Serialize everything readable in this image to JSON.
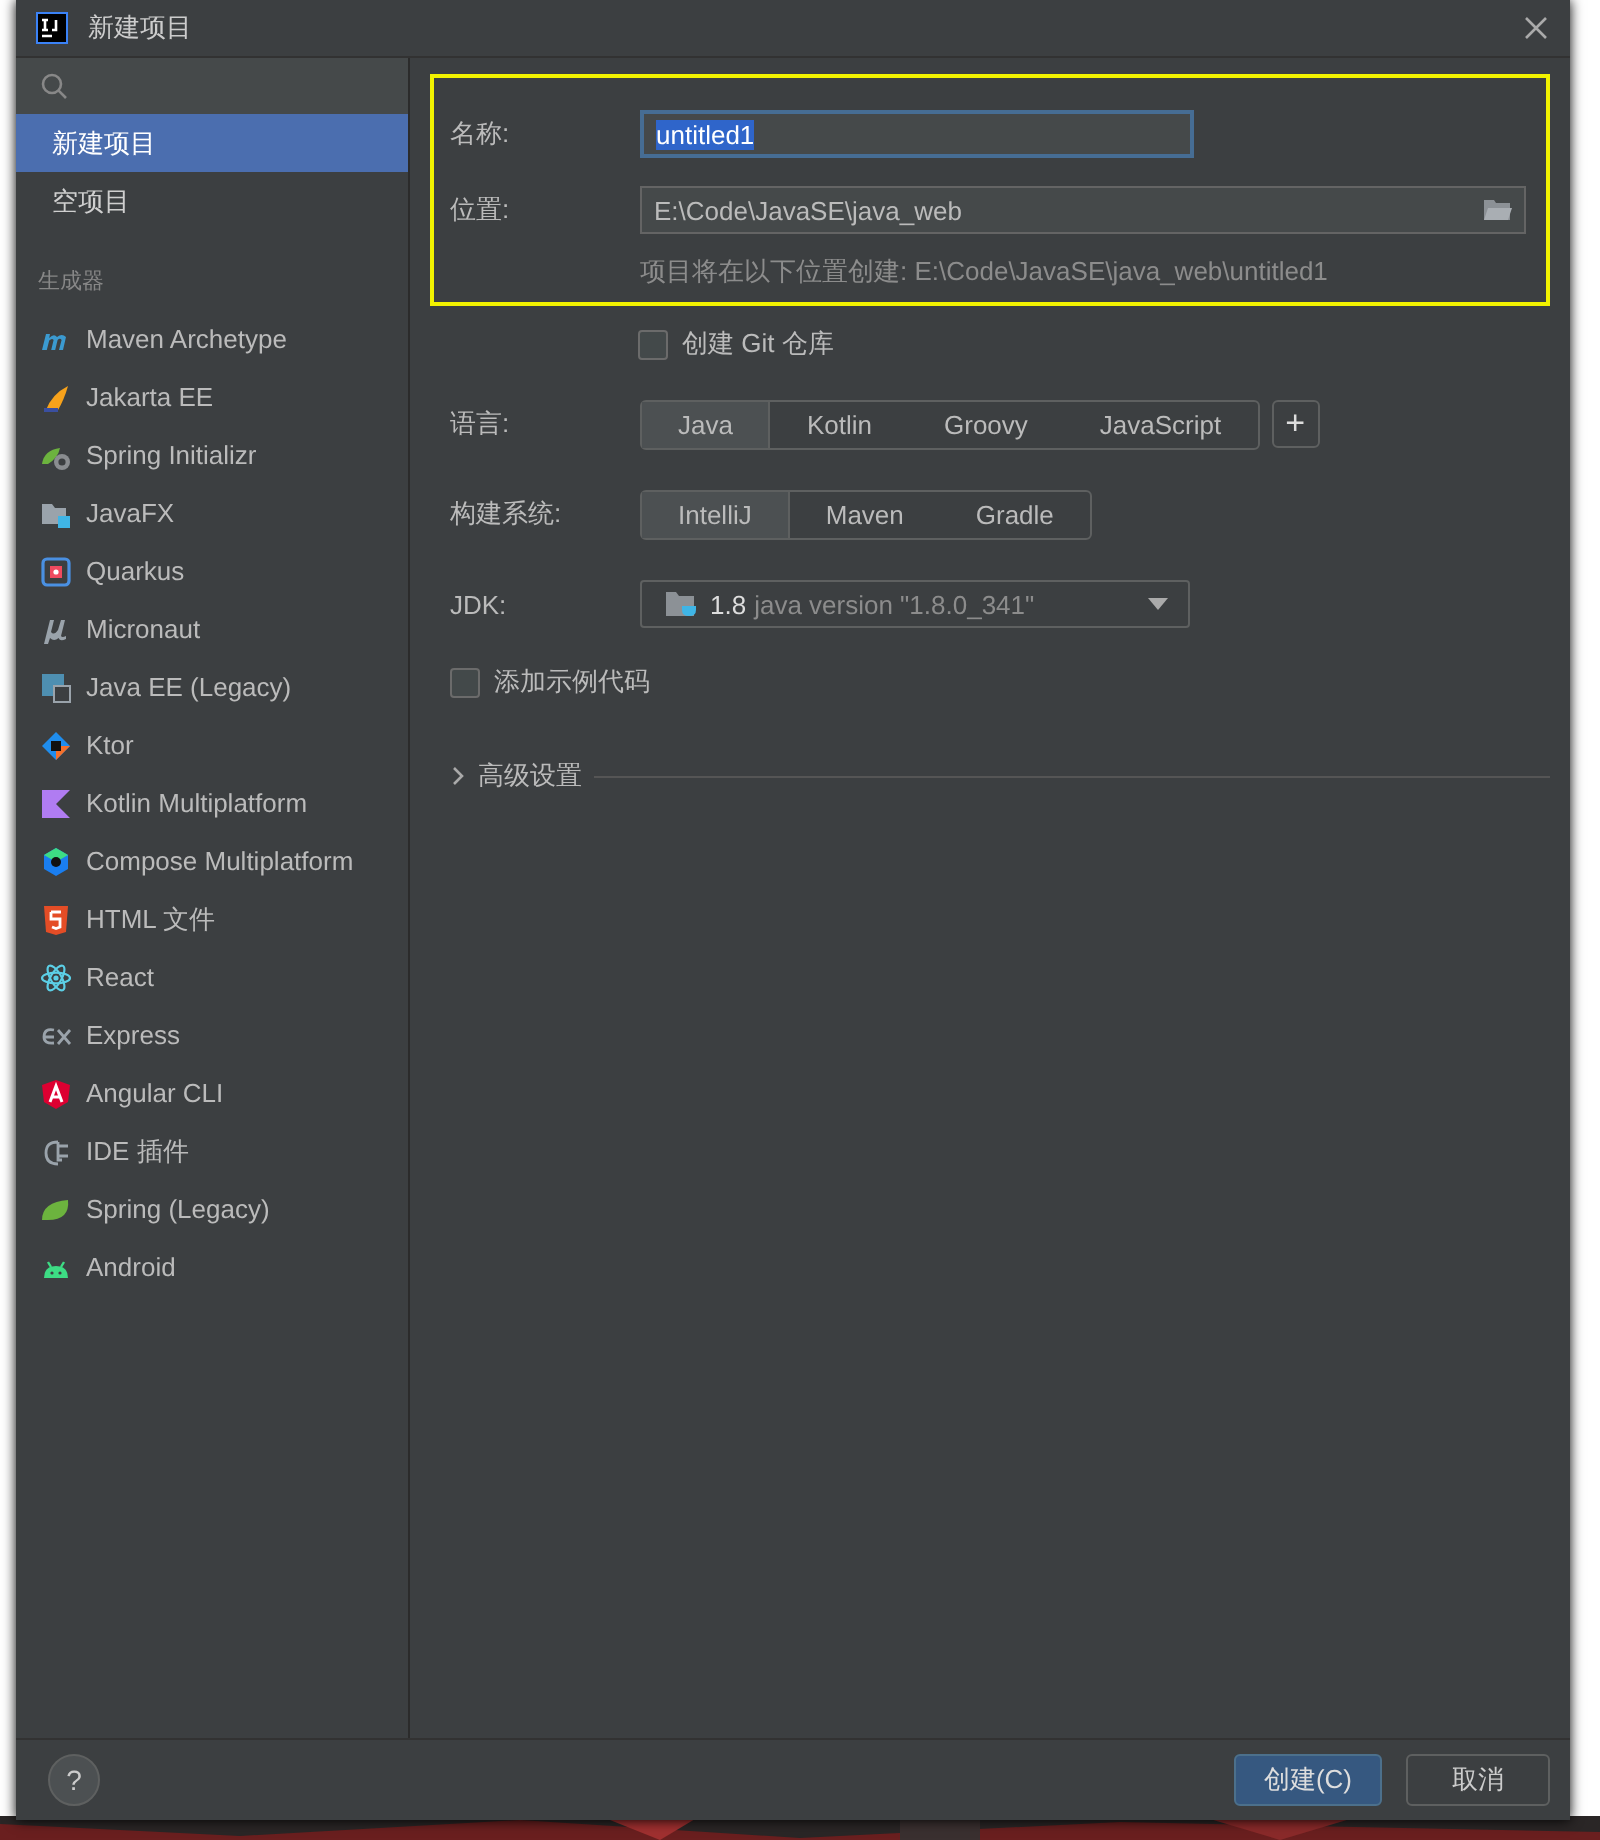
{
  "window": {
    "title": "新建项目"
  },
  "sidebar": {
    "items": [
      {
        "label": "新建项目",
        "selected": true
      },
      {
        "label": "空项目",
        "selected": false
      }
    ],
    "section": "生成器",
    "generators": [
      {
        "label": "Maven Archetype"
      },
      {
        "label": "Jakarta EE"
      },
      {
        "label": "Spring Initializr"
      },
      {
        "label": "JavaFX"
      },
      {
        "label": "Quarkus"
      },
      {
        "label": "Micronaut"
      },
      {
        "label": "Java EE (Legacy)"
      },
      {
        "label": "Ktor"
      },
      {
        "label": "Kotlin Multiplatform"
      },
      {
        "label": "Compose Multiplatform"
      },
      {
        "label": "HTML 文件"
      },
      {
        "label": "React"
      },
      {
        "label": "Express"
      },
      {
        "label": "Angular CLI"
      },
      {
        "label": "IDE 插件"
      },
      {
        "label": "Spring (Legacy)"
      },
      {
        "label": "Android"
      }
    ]
  },
  "form": {
    "name": {
      "label": "名称:",
      "value": "untitled1"
    },
    "location": {
      "label": "位置:",
      "value": "E:\\Code\\JavaSE\\java_web",
      "hint": "项目将在以下位置创建: E:\\Code\\JavaSE\\java_web\\untitled1"
    },
    "git": {
      "label": "创建 Git 仓库",
      "checked": false
    },
    "language": {
      "label": "语言:",
      "options": [
        {
          "label": "Java",
          "selected": true
        },
        {
          "label": "Kotlin",
          "selected": false
        },
        {
          "label": "Groovy",
          "selected": false
        },
        {
          "label": "JavaScript",
          "selected": false
        }
      ],
      "add": "+"
    },
    "build_system": {
      "label": "构建系统:",
      "options": [
        {
          "label": "IntelliJ",
          "selected": true
        },
        {
          "label": "Maven",
          "selected": false
        },
        {
          "label": "Gradle",
          "selected": false
        }
      ]
    },
    "jdk": {
      "label": "JDK:",
      "version": "1.8",
      "detail": "java version \"1.8.0_341\""
    },
    "sample_code": {
      "label": "添加示例代码",
      "checked": false
    },
    "advanced": {
      "label": "高级设置",
      "expanded": false
    }
  },
  "buttons": {
    "help": "?",
    "create": "创建(C)",
    "cancel": "取消"
  }
}
